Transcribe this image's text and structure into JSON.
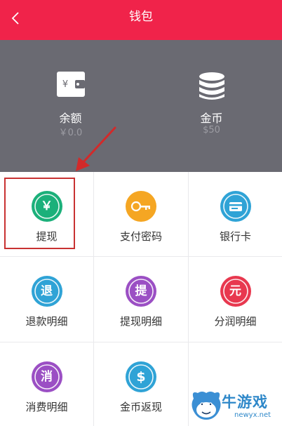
{
  "header": {
    "title": "钱包"
  },
  "summary": [
    {
      "label": "余额",
      "value": "￥0.0",
      "icon": "wallet-icon"
    },
    {
      "label": "金币",
      "value": "$50",
      "icon": "coin-stack-icon"
    }
  ],
  "menu": [
    {
      "label": "提现",
      "glyph": "￥",
      "color": "#1bb07a",
      "icon": "yen-icon"
    },
    {
      "label": "支付密码",
      "glyph": "",
      "color": "#f5a623",
      "icon": "key-icon"
    },
    {
      "label": "银行卡",
      "glyph": "",
      "color": "#2fa3d6",
      "icon": "card-icon"
    },
    {
      "label": "退款明细",
      "glyph": "退",
      "color": "#2fa3d6",
      "icon": "refund-icon"
    },
    {
      "label": "提现明细",
      "glyph": "提",
      "color": "#9b4fc4",
      "icon": "withdraw-detail-icon"
    },
    {
      "label": "分润明细",
      "glyph": "元",
      "color": "#e8384f",
      "icon": "yuan-icon"
    },
    {
      "label": "消费明细",
      "glyph": "消",
      "color": "#9b4fc4",
      "icon": "consume-icon"
    },
    {
      "label": "金币返现",
      "glyph": "$",
      "color": "#2fa3d6",
      "icon": "dollar-icon"
    }
  ],
  "watermark": {
    "text": "牛游戏",
    "url": "newyx.net"
  }
}
